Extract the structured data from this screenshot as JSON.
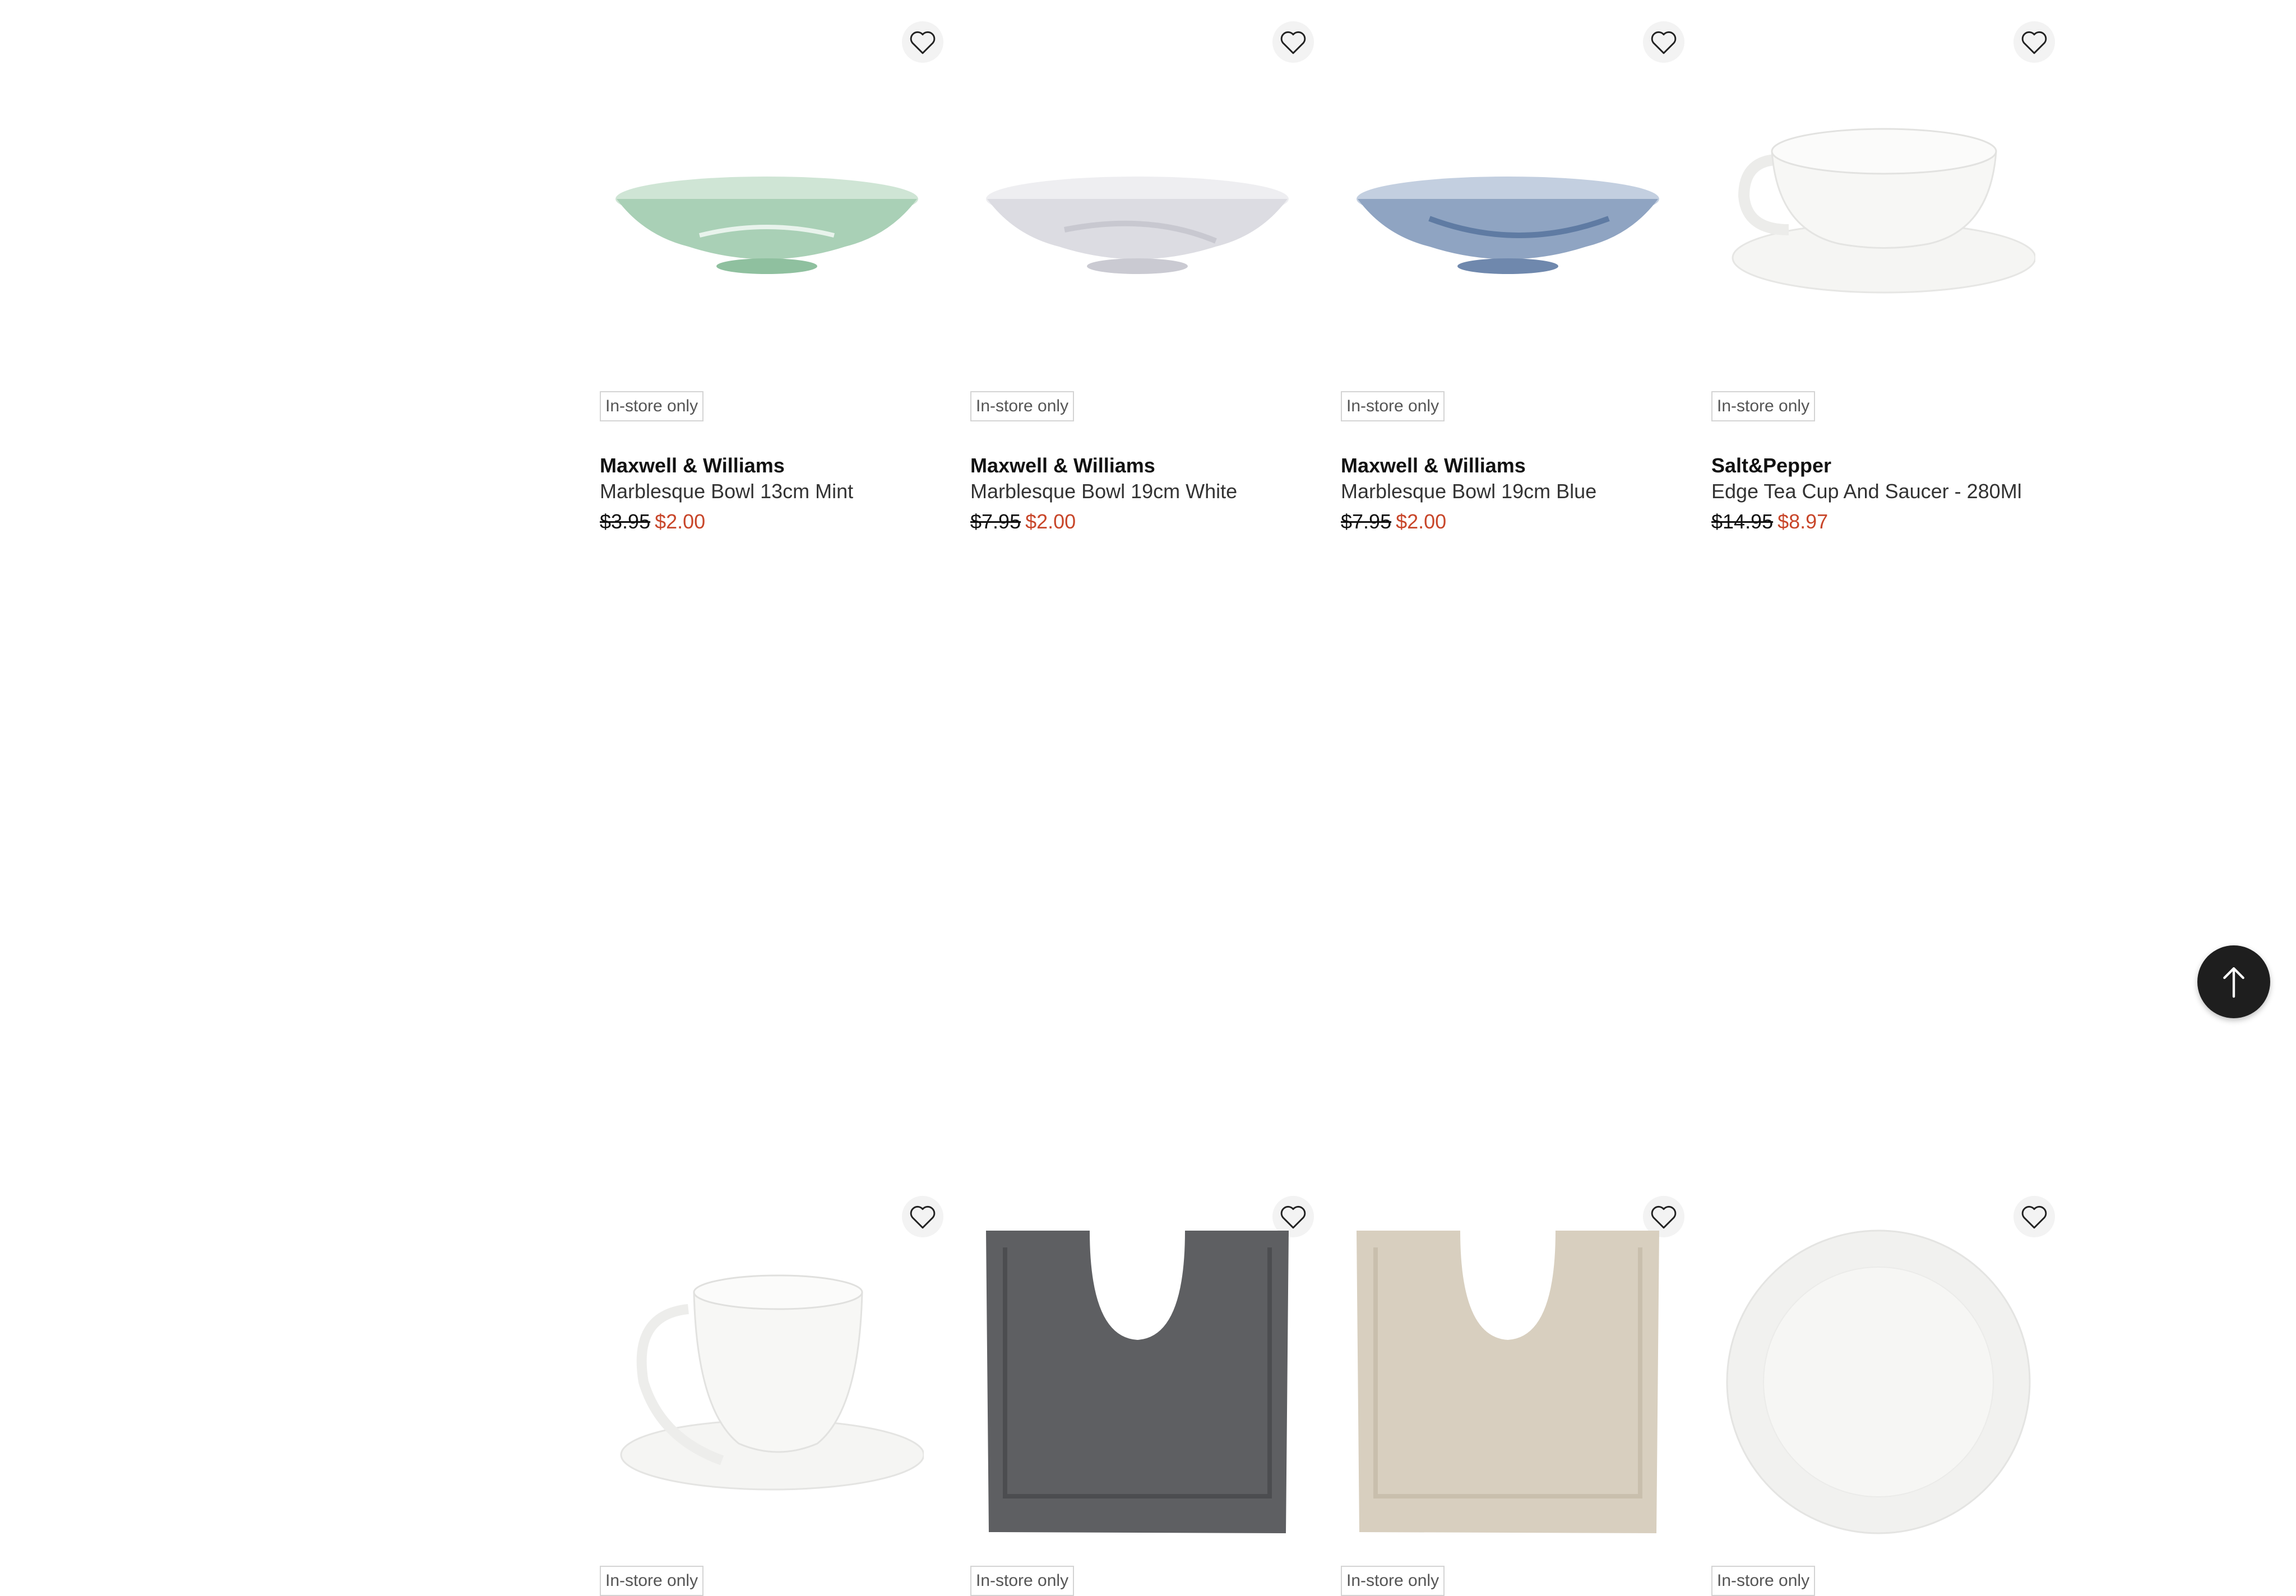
{
  "products": [
    {
      "badge": "In-store only",
      "brand": "Maxwell & Williams",
      "name": "Marblesque Bowl 13cm Mint",
      "was": "$3.95",
      "now": "$2.00",
      "image": "mint-marble-bowl",
      "color": "#b9d9c3"
    },
    {
      "badge": "In-store only",
      "brand": "Maxwell & Williams",
      "name": "Marblesque Bowl 19cm White",
      "was": "$7.95",
      "now": "$2.00",
      "image": "white-marble-bowl",
      "color": "#e6e6ea"
    },
    {
      "badge": "In-store only",
      "brand": "Maxwell & Williams",
      "name": "Marblesque Bowl 19cm Blue",
      "was": "$7.95",
      "now": "$2.00",
      "image": "blue-marble-bowl",
      "color": "#8ea2c0"
    },
    {
      "badge": "In-store only",
      "brand": "Salt&Pepper",
      "name": "Edge Tea Cup And Saucer - 280Ml",
      "was": "$14.95",
      "now": "$8.97",
      "image": "white-tea-cup-saucer",
      "color": "#f4f4f2"
    },
    {
      "badge": "In-store only",
      "image": "white-espresso-cup-saucer",
      "color": "#f4f4f2"
    },
    {
      "badge": "In-store only",
      "image": "charcoal-pedestal-mat",
      "color": "#5d5d60"
    },
    {
      "badge": "In-store only",
      "image": "beige-pedestal-mat",
      "color": "#d6ccbc"
    },
    {
      "badge": "In-store only",
      "image": "white-dinner-plate",
      "color": "#f2f2f0"
    }
  ],
  "icons": {
    "wishlist": "heart-outline-icon",
    "scroll_top": "arrow-up-icon"
  },
  "colors": {
    "sale_price": "#c8462a",
    "badge_border": "#d4d4d4",
    "scroll_top_bg": "#1e1e1e"
  }
}
